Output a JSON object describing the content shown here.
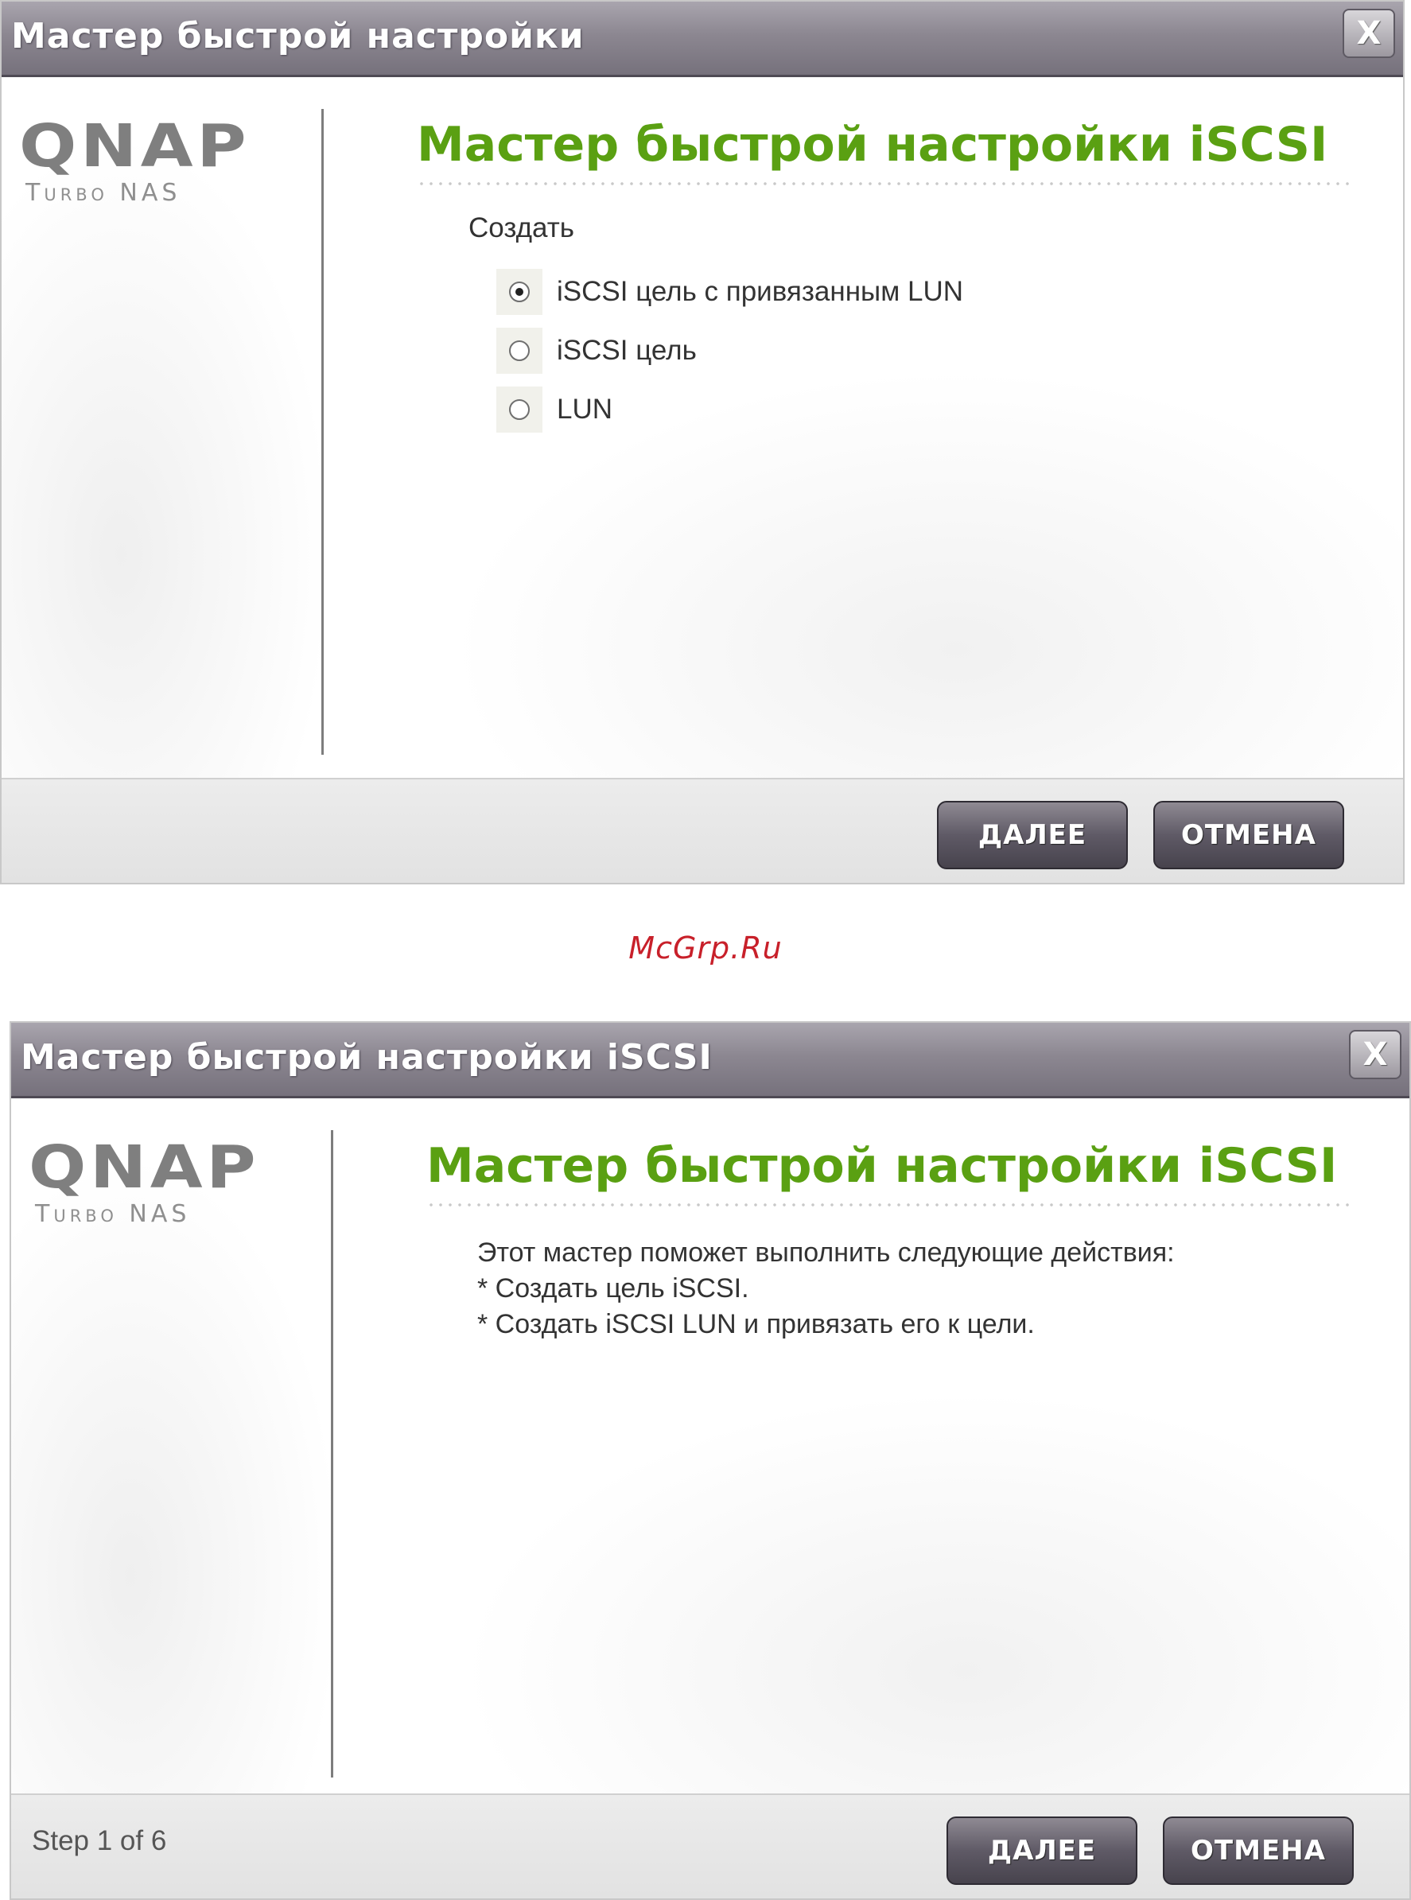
{
  "dialog1": {
    "title": "Мастер быстрой настройки",
    "close_label": "X",
    "logo": {
      "brand": "QNAP",
      "sub": "Turbo NAS"
    },
    "heading": "Мастер быстрой настройки iSCSI",
    "create_label": "Создать",
    "options": [
      {
        "label": "iSCSI цель с привязанным LUN",
        "selected": true
      },
      {
        "label": "iSCSI цель",
        "selected": false
      },
      {
        "label": "LUN",
        "selected": false
      }
    ],
    "next_label": "ДАЛЕЕ",
    "cancel_label": "ОТМЕНА"
  },
  "watermark": "McGrp.Ru",
  "dialog2": {
    "title": "Мастер быстрой настройки iSCSI",
    "close_label": "X",
    "logo": {
      "brand": "QNAP",
      "sub": "Turbo NAS"
    },
    "heading": "Мастер быстрой настройки iSCSI",
    "info_lines": [
      "Этот мастер поможет выполнить следующие действия:",
      "* Создать цель iSCSI.",
      "* Создать iSCSI LUN и привязать его к цели."
    ],
    "step": "Step 1 of 6",
    "next_label": "ДАЛЕЕ",
    "cancel_label": "ОТМЕНА"
  },
  "colors": {
    "heading_green": "#5aa012",
    "titlebar": "#8c8791",
    "button": "#5f5a66",
    "watermark_red": "#c8202a"
  }
}
